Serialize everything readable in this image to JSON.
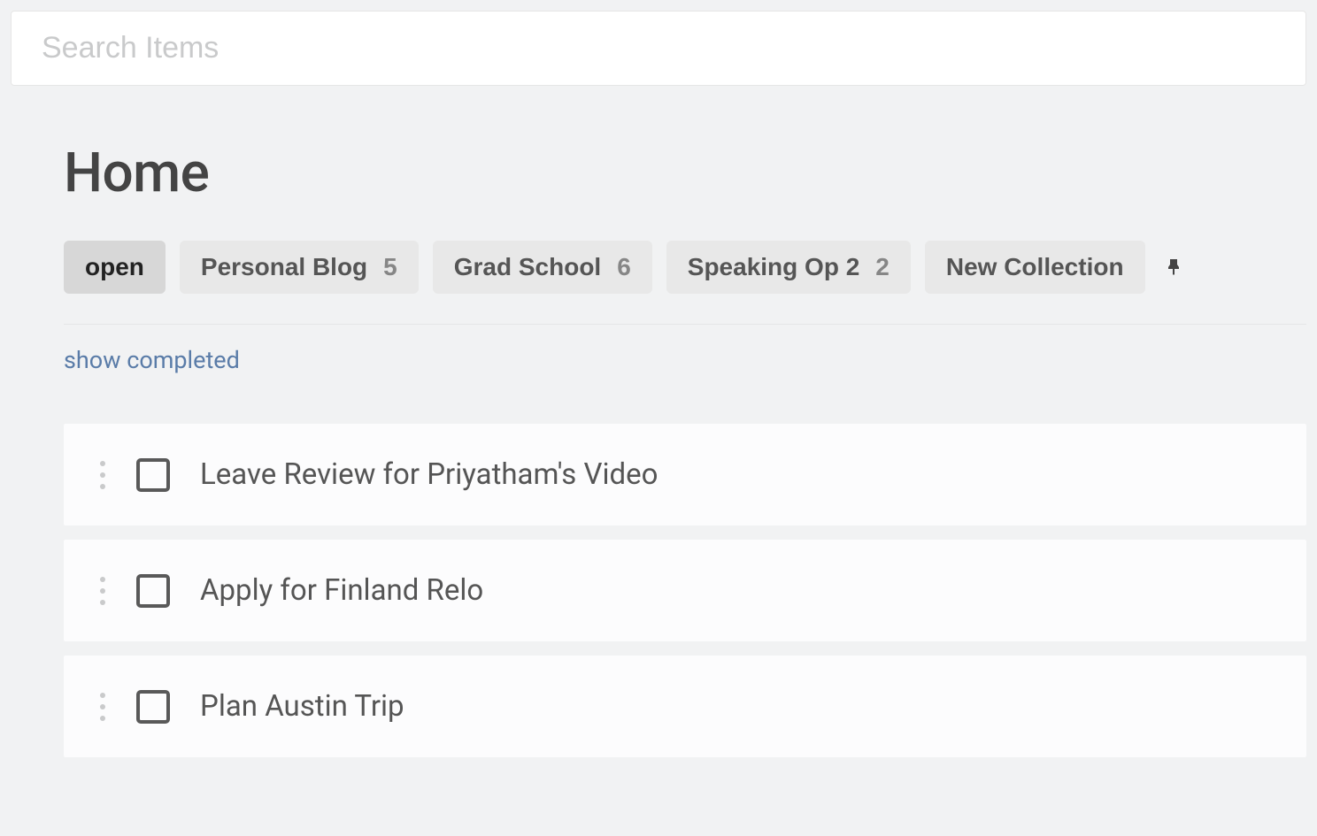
{
  "search": {
    "placeholder": "Search Items"
  },
  "page": {
    "title": "Home"
  },
  "filters": [
    {
      "label": "open",
      "count": null,
      "active": true
    },
    {
      "label": "Personal Blog",
      "count": "5",
      "active": false
    },
    {
      "label": "Grad School",
      "count": "6",
      "active": false
    },
    {
      "label": "Speaking Op 2",
      "count": "2",
      "active": false
    },
    {
      "label": "New Collection",
      "count": null,
      "active": false
    }
  ],
  "links": {
    "show_completed": "show completed"
  },
  "tasks": [
    {
      "title": "Leave Review for Priyatham's Video"
    },
    {
      "title": "Apply for Finland Relo"
    },
    {
      "title": "Plan Austin Trip"
    }
  ]
}
